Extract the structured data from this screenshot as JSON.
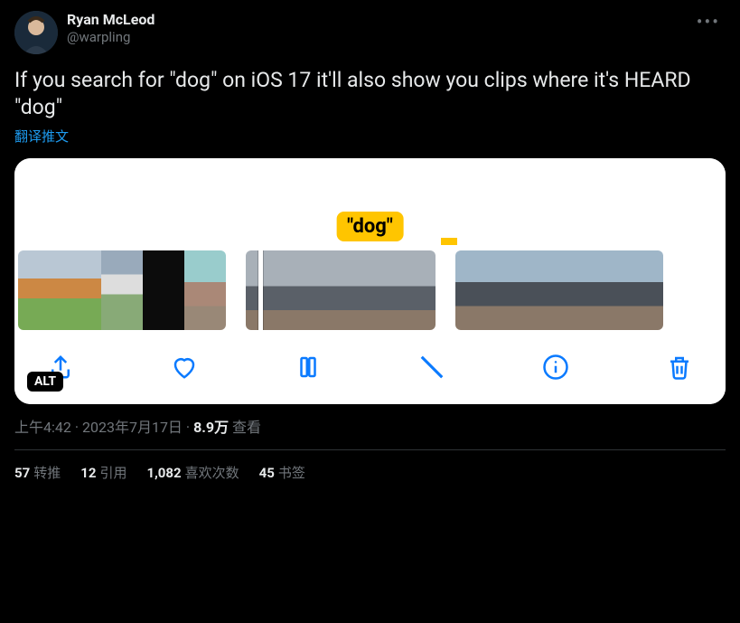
{
  "author": {
    "display_name": "Ryan McLeod",
    "handle": "@warpling"
  },
  "tweet_text": "If you search for \"dog\" on iOS 17 it'll also show you clips where it's HEARD \"dog\"",
  "translate_label": "翻译推文",
  "media": {
    "chip_text": "\"dog\"",
    "alt_badge": "ALT",
    "toolbar": {
      "share": "share-icon",
      "like": "heart-icon",
      "playpause": "pause-icon",
      "mute": "mute-icon",
      "info": "info-icon",
      "trash": "trash-icon"
    }
  },
  "meta": {
    "time": "上午4:42",
    "sep1": " · ",
    "date": "2023年7月17日",
    "sep2": " · ",
    "views_count": "8.9万",
    "views_label": " 查看"
  },
  "stats": {
    "retweets": {
      "count": "57",
      "label": "转推"
    },
    "quotes": {
      "count": "12",
      "label": "引用"
    },
    "likes": {
      "count": "1,082",
      "label": "喜欢次数"
    },
    "bookmarks": {
      "count": "45",
      "label": "书签"
    }
  }
}
